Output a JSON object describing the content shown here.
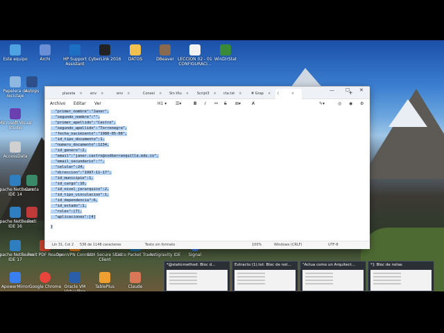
{
  "desktop": {
    "icons": [
      {
        "label": "Este equipo",
        "color": "#4fa3e0"
      },
      {
        "label": "Archi",
        "color": "#6a8fd6"
      },
      {
        "label": "HP Support Assistant",
        "color": "#1d6fc4"
      },
      {
        "label": "CyberLink 2016",
        "color": "#222222"
      },
      {
        "label": "DATOS",
        "color": "#f2c14e"
      },
      {
        "label": "DBeaver",
        "color": "#8a6a4e"
      },
      {
        "label": "LECCION 02 - 01 CONFIGURACI...",
        "color": "#f2f2f2"
      },
      {
        "label": "WinDirStat",
        "color": "#3a8a3a"
      },
      {
        "label": "Papelera de reciclaje",
        "color": "#8fb8e0"
      },
      {
        "label": "Autops",
        "color": "#2d4f8a"
      },
      {
        "label": "Microsoft Visual Studio",
        "color": "#6a3fb0"
      },
      {
        "label": "AccessData",
        "color": "#d0d0d0"
      },
      {
        "label": "Camta",
        "color": "#3a8a6a"
      },
      {
        "label": "Apache NetBeans IDE 14",
        "color": "#2f7fc0"
      },
      {
        "label": "Forti",
        "color": "#c03a3a"
      },
      {
        "label": "Apache NetBeans IDE 16",
        "color": "#2f7fc0"
      },
      {
        "label": "Apache NetBeans IDE 17",
        "color": "#2f7fc0"
      },
      {
        "label": "Foxit PDF Reader",
        "color": "#d0432c"
      },
      {
        "label": "OpenVPN Connect",
        "color": "#ea7e20"
      },
      {
        "label": "SSH Secure Shell Client",
        "color": "#3a3a3a"
      },
      {
        "label": "Cisco Packet Tracer",
        "color": "#1b6fa8"
      },
      {
        "label": "Signal",
        "color": "#3a76f0"
      },
      {
        "label": "ApowerMirror",
        "color": "#3a7ff0"
      },
      {
        "label": "Google Chrome",
        "color": "#e8453c"
      },
      {
        "label": "Oracle VM VirtualBox",
        "color": "#2a5fa8"
      },
      {
        "label": "TablePlus",
        "color": "#f0a030"
      },
      {
        "label": "Claude",
        "color": "#d97757"
      },
      {
        "label": "Antigravity IDE",
        "color": "#3a3a3a"
      }
    ]
  },
  "notepad": {
    "tabs": [
      {
        "label": "placeta"
      },
      {
        "label": "env"
      },
      {
        "label": "env"
      },
      {
        "label": "Conexi"
      },
      {
        "label": "Sin títu"
      },
      {
        "label": "Script3"
      },
      {
        "label": "cta.txt"
      },
      {
        "label": "# Grap"
      },
      {
        "label": "("
      }
    ],
    "menu": {
      "file": "Archivo",
      "edit": "Editar",
      "view": "Ver"
    },
    "heading_select": "H1",
    "lines": [
      "  \"primer_nombre\":\"Janer\",",
      "  \"segundo_nombre\":\"\",",
      "  \"primer_apellido\":\"Castro\",",
      "  \"segundo_apellido\":\"Torrenegra\",",
      "  \"fecha_nacimiento\":\"1980-05-08\",",
      "  \"id_tipo_documento\":1,",
      "  \"numero_documento\":1234,",
      "  \"id_genero\":2,",
      "  \"email\":\"janer.castro@svdbarranquilla.edu.co\",",
      "  \"email_secundario\":\"\",",
      "  \"celular\":24,",
      "  \"direccion\":\"1997-11-17\",",
      "  \"id_municipio\":1,",
      "  \"id_cargo\":10,",
      "  \"id_nivel_jerarquico\":2,",
      "  \"id_tipo_vinculacion\":1,",
      "  \"id_dependencia\":6,",
      "  \"id_estado\":1,",
      "  \"roles\":[7],",
      "  \"aplicaciones\":[4]",
      "}"
    ],
    "status": {
      "position": "Lín 31, Col 2",
      "chars": "536 de 1148 caracteres",
      "format": "Texto sin formato",
      "zoom": "100%",
      "line_endings": "Windows (CRLF)",
      "encoding": "UTF-8"
    }
  },
  "taskbar_previews": [
    {
      "label": "*@staticmethod: Bloc d..."
    },
    {
      "label": "Extracto (1).txt: Bloc de not..."
    },
    {
      "label": "\"Actua como un Arquitect..."
    },
    {
      "label": "*]: Bloc de notas"
    }
  ],
  "colors": {
    "selection": "#b5d3f5",
    "tab_bar": "#eef2f6",
    "accent": "#1d6fc4"
  }
}
